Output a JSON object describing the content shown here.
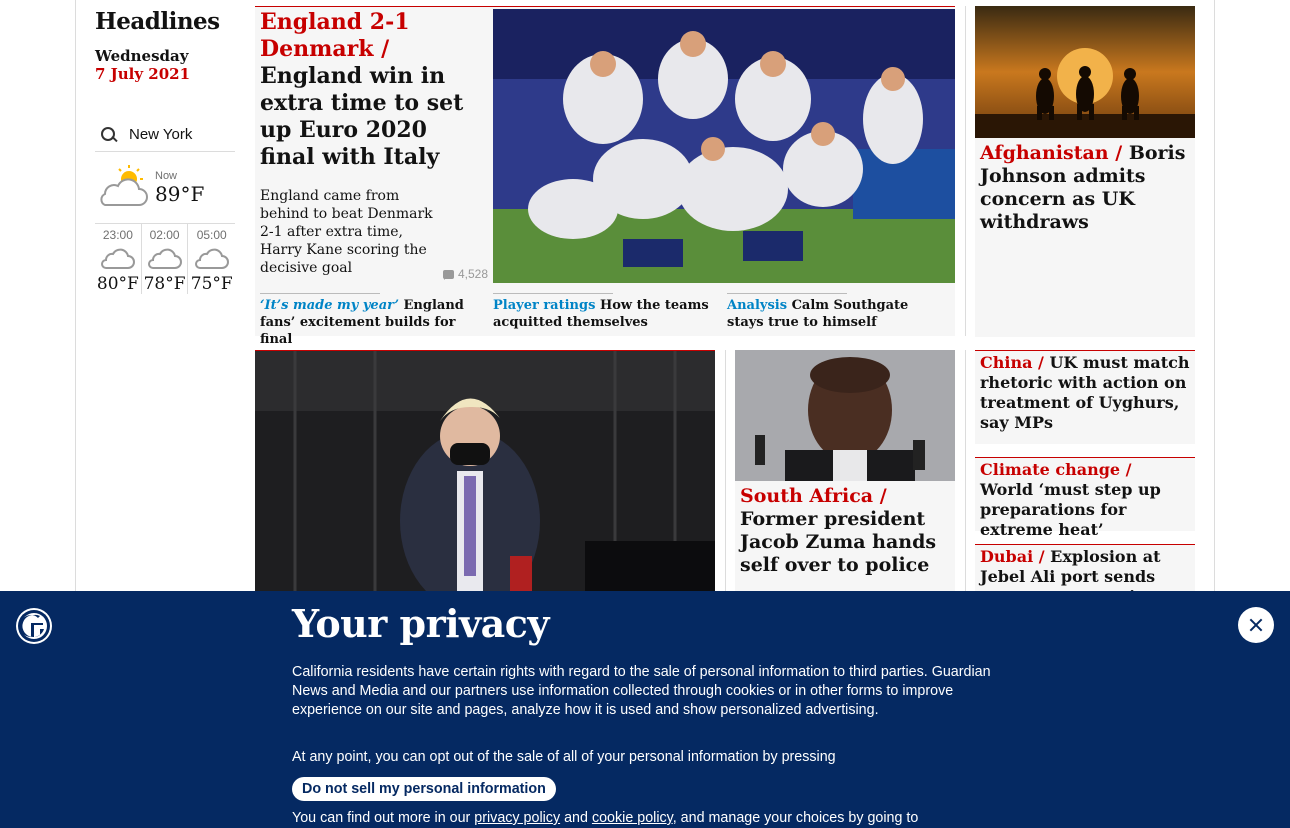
{
  "sidebar": {
    "title": "Headlines",
    "day": "Wednesday",
    "date": "7 July 2021"
  },
  "weather": {
    "location": "New York",
    "now_label": "Now",
    "now_temp": "89°F",
    "forecast": [
      {
        "time": "23:00",
        "temp": "80°F"
      },
      {
        "time": "02:00",
        "temp": "78°F"
      },
      {
        "time": "05:00",
        "temp": "75°F"
      }
    ]
  },
  "lead": {
    "kicker": "England 2-1 Denmark /",
    "headline": "England win in extra time to set up Euro 2020 final with Italy",
    "standfirst": "England came from behind to beat Denmark 2-1 after extra time, Harry Kane scoring the decisive goal",
    "comments": "4,528",
    "sublinks": [
      {
        "kicker": "‘It’s made my year’",
        "text": "England fans’ excitement builds for final"
      },
      {
        "kicker": "Player ratings",
        "text": "How the teams acquitted themselves"
      },
      {
        "kicker": "Analysis",
        "text": "Calm Southgate stays true to himself"
      }
    ]
  },
  "afghanistan": {
    "kicker": "Afghanistan /",
    "headline": "Boris Johnson admits concern as UK withdraws"
  },
  "china": {
    "kicker": "China /",
    "headline": "UK must match rhetoric with action on treatment of Uyghurs, say MPs"
  },
  "climate": {
    "kicker": "Climate change /",
    "headline": "World ‘must step up preparations for extreme heat’"
  },
  "dubai": {
    "kicker": "Dubai /",
    "headline": "Explosion at Jebel Ali port sends tremors across city"
  },
  "zuma": {
    "kicker": "South Africa /",
    "headline": "Former president Jacob Zuma hands self over to police"
  },
  "privacy": {
    "title": "Your privacy",
    "para1": "California residents have certain rights with regard to the sale of personal information to third parties. Guardian News and Media and our partners use information collected through cookies or in other forms to improve experience on our site and pages, analyze how it is used and show personalized advertising.",
    "para2": "At any point, you can opt out of the sale of all of your personal information by pressing",
    "button": "Do not sell my personal information",
    "more_prefix": "You can find out more in our",
    "privacy_link": "privacy policy",
    "and": "and",
    "cookie_link": "cookie policy",
    "more_suffix": ", and manage your choices by going to"
  },
  "colors": {
    "brand": "#052962",
    "news": "#c70000",
    "sport_link": "#0084c6"
  }
}
